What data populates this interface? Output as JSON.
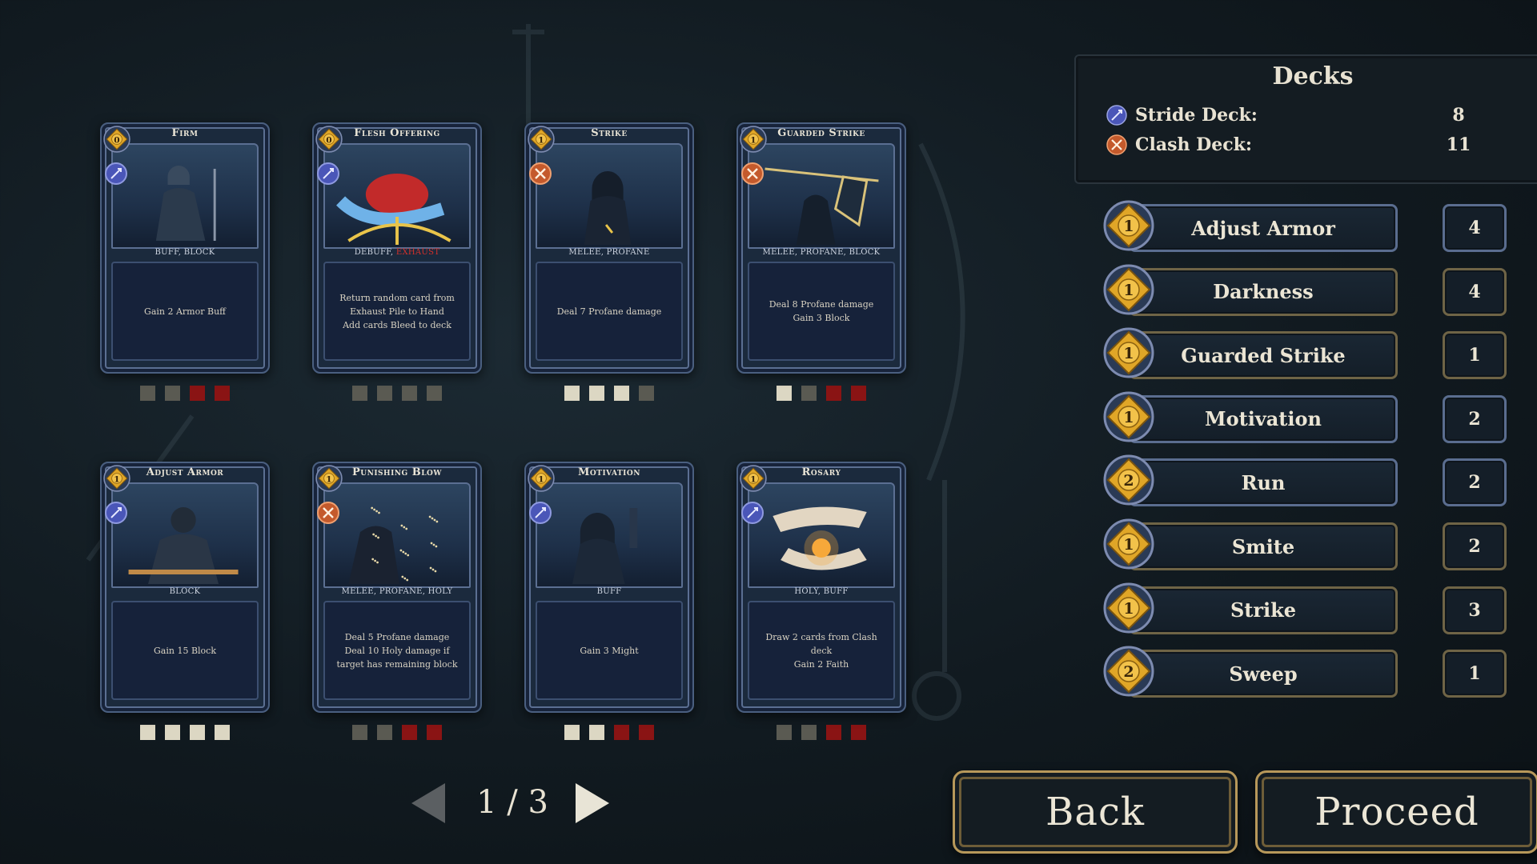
{
  "cards": [
    {
      "name": "Firm",
      "cost": "0",
      "deck": "stride",
      "tags": "BUFF, BLOCK",
      "tags_extra": "",
      "text": "Gain 2 Armor Buff",
      "pips": [
        "gray",
        "gray",
        "red",
        "red"
      ],
      "art": "knight-kneel"
    },
    {
      "name": "Flesh Offering",
      "cost": "0",
      "deck": "stride",
      "tags": "DEBUFF, ",
      "tags_extra": "EXHAUST",
      "text": "Return random card from Exhaust Pile to Hand\nAdd cards Bleed to deck",
      "pips": [
        "gray",
        "gray",
        "gray",
        "gray"
      ],
      "art": "heart-offering"
    },
    {
      "name": "Strike",
      "cost": "1",
      "deck": "clash",
      "tags": "MELEE, PROFANE",
      "tags_extra": "",
      "text": "Deal 7 Profane damage",
      "pips": [
        "white",
        "white",
        "white",
        "gray"
      ],
      "art": "hooded-figure"
    },
    {
      "name": "Guarded Strike",
      "cost": "1",
      "deck": "clash",
      "tags": "MELEE, PROFANE, BLOCK",
      "tags_extra": "",
      "text": "Deal 8 Profane damage\nGain 3 Block",
      "pips": [
        "white",
        "gray",
        "red",
        "red"
      ],
      "art": "spear-shield"
    },
    {
      "name": "Adjust Armor",
      "cost": "1",
      "deck": "stride",
      "tags": "BLOCK",
      "tags_extra": "",
      "text": "Gain 15 Block",
      "pips": [
        "white",
        "white",
        "white",
        "white"
      ],
      "art": "knight-sit"
    },
    {
      "name": "Punishing Blow",
      "cost": "1",
      "deck": "clash",
      "tags": "MELEE, PROFANE, HOLY",
      "tags_extra": "",
      "text": "Deal 5 Profane damage\nDeal 10 Holy damage if target has remaining block",
      "pips": [
        "gray",
        "gray",
        "red",
        "red"
      ],
      "art": "sparks"
    },
    {
      "name": "Motivation",
      "cost": "1",
      "deck": "stride",
      "tags": "BUFF",
      "tags_extra": "",
      "text": "Gain 3 Might",
      "pips": [
        "white",
        "white",
        "red",
        "red"
      ],
      "art": "raised-fist"
    },
    {
      "name": "Rosary",
      "cost": "1",
      "deck": "stride",
      "tags": "HOLY, BUFF",
      "tags_extra": "",
      "text": "Draw 2 cards from Clash deck\nGain 2 Faith",
      "pips": [
        "gray",
        "gray",
        "red",
        "red"
      ],
      "art": "rosary-hands"
    }
  ],
  "pager": {
    "text": "1 / 3",
    "current": 1,
    "total": 3
  },
  "decks": {
    "title": "Decks",
    "stride_label": "Stride Deck:",
    "stride_count": "8",
    "clash_label": "Clash Deck:",
    "clash_count": "11"
  },
  "card_list": [
    {
      "name": "Adjust Armor",
      "cost": "1",
      "count": "4",
      "frame": "blue"
    },
    {
      "name": "Darkness",
      "cost": "1",
      "count": "4",
      "frame": "gold"
    },
    {
      "name": "Guarded Strike",
      "cost": "1",
      "count": "1",
      "frame": "gold"
    },
    {
      "name": "Motivation",
      "cost": "1",
      "count": "2",
      "frame": "blue"
    },
    {
      "name": "Run",
      "cost": "2",
      "count": "2",
      "frame": "blue"
    },
    {
      "name": "Smite",
      "cost": "1",
      "count": "2",
      "frame": "gold"
    },
    {
      "name": "Strike",
      "cost": "1",
      "count": "3",
      "frame": "gold"
    },
    {
      "name": "Sweep",
      "cost": "2",
      "count": "1",
      "frame": "gold"
    }
  ],
  "buttons": {
    "back": "Back",
    "proceed": "Proceed"
  },
  "colors": {
    "gold": "#e0a627",
    "stride_blue": "#4a56b8",
    "clash_orange": "#c45a2c",
    "pip_white": "#dcd7c3",
    "pip_gray": "#5a5a52",
    "pip_red": "#8a1414"
  }
}
